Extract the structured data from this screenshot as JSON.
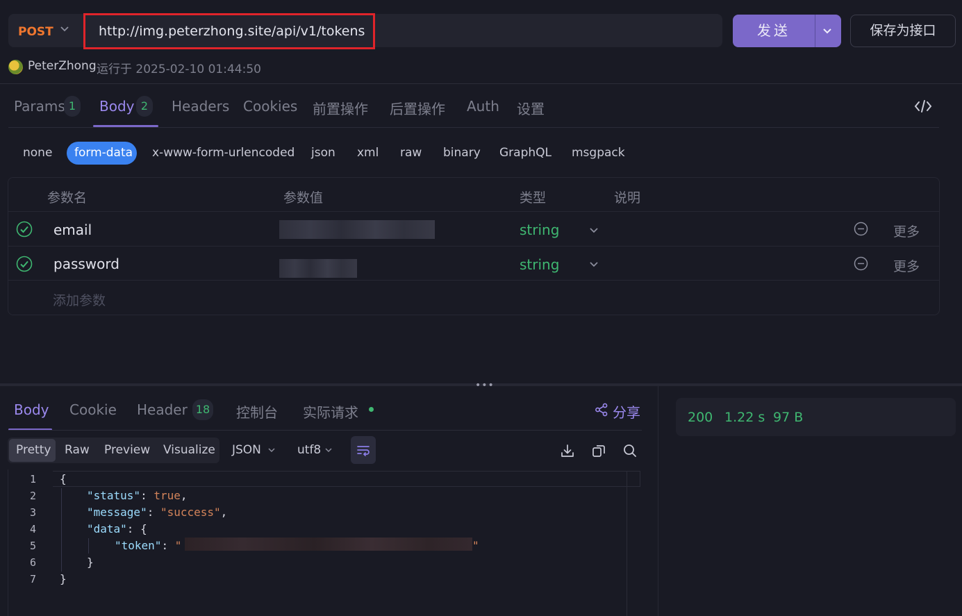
{
  "request": {
    "method": "POST",
    "url": "http://img.peterzhong.site/api/v1/tokens",
    "send_label": "发送",
    "save_label": "保存为接口",
    "user": "PeterZhong",
    "run_info": "运行于 2025-02-10 01:44:50"
  },
  "request_tabs": [
    {
      "label": "Params",
      "badge": "1"
    },
    {
      "label": "Body",
      "badge": "2",
      "active": true
    },
    {
      "label": "Headers"
    },
    {
      "label": "Cookies"
    },
    {
      "label": "前置操作"
    },
    {
      "label": "后置操作"
    },
    {
      "label": "Auth"
    },
    {
      "label": "设置"
    }
  ],
  "body_types": [
    "none",
    "form-data",
    "x-www-form-urlencoded",
    "json",
    "xml",
    "raw",
    "binary",
    "GraphQL",
    "msgpack"
  ],
  "body_type_selected": "form-data",
  "params_table": {
    "headers": [
      "参数名",
      "参数值",
      "类型",
      "说明"
    ],
    "rows": [
      {
        "name": "email",
        "type": "string",
        "more": "更多",
        "enabled": true
      },
      {
        "name": "password",
        "type": "string",
        "more": "更多",
        "enabled": true
      }
    ],
    "add_placeholder": "添加参数"
  },
  "response_tabs": [
    {
      "label": "Body",
      "active": true
    },
    {
      "label": "Cookie"
    },
    {
      "label": "Header",
      "badge": "18"
    },
    {
      "label": "控制台"
    },
    {
      "label": "实际请求"
    }
  ],
  "share_label": "分享",
  "stats": {
    "status": "200",
    "time": "1.22 s",
    "size": "97 B"
  },
  "view_modes": [
    "Pretty",
    "Raw",
    "Preview",
    "Visualize"
  ],
  "view_mode_selected": "Pretty",
  "format": "JSON",
  "encoding": "utf8",
  "code": {
    "line_numbers": [
      "1",
      "2",
      "3",
      "4",
      "5",
      "6",
      "7"
    ],
    "open_brace": "{",
    "close_brace": "}",
    "status_key": "\"status\"",
    "status_value": "true",
    "message_key": "\"message\"",
    "message_value": "\"success\"",
    "data_key": "\"data\"",
    "token_key": "\"token\""
  },
  "colors": {
    "accent": "#7b68c9",
    "method": "#f0772f",
    "success": "#3fb771",
    "highlight_box": "#e0242a"
  }
}
